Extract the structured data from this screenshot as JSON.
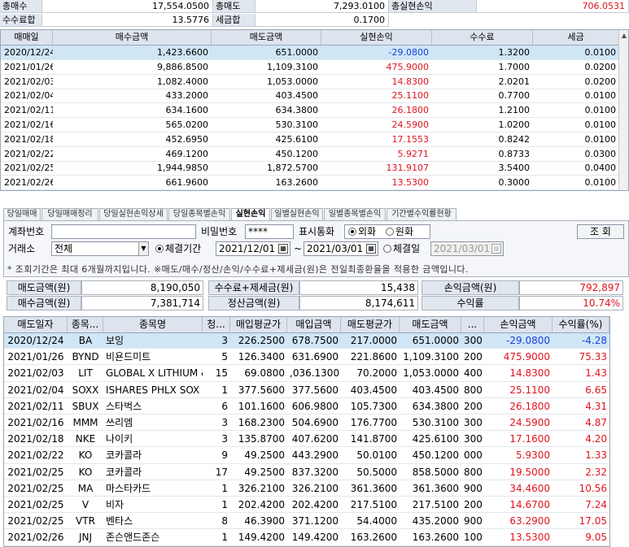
{
  "summary": {
    "row1": [
      {
        "label": "총매수",
        "value": "17,554.0500"
      },
      {
        "label": "총매도",
        "value": "7,293.0100"
      },
      {
        "label": "총실현손익",
        "value": "706.0531"
      }
    ],
    "row2": [
      {
        "label": "수수료합",
        "value": "13.5776"
      },
      {
        "label": "세금합",
        "value": "0.1700"
      }
    ]
  },
  "top_grid": {
    "headers": [
      "매매일",
      "매수금액",
      "매도금액",
      "실현손익",
      "수수료",
      "세금"
    ],
    "rows": [
      [
        "2020/12/24",
        "1,423.6600",
        "651.0000",
        "-29.0800",
        "1.3200",
        "0.0100"
      ],
      [
        "2021/01/26",
        "9,886.8500",
        "1,109.3100",
        "475.9000",
        "1.7000",
        "0.0200"
      ],
      [
        "2021/02/03",
        "1,082.4000",
        "1,053.0000",
        "14.8300",
        "2.0201",
        "0.0200"
      ],
      [
        "2021/02/04",
        "433.2000",
        "403.4500",
        "25.1100",
        "0.7700",
        "0.0100"
      ],
      [
        "2021/02/11",
        "634.1600",
        "634.3800",
        "26.1800",
        "1.2100",
        "0.0100"
      ],
      [
        "2021/02/16",
        "565.0200",
        "530.3100",
        "24.5900",
        "1.0200",
        "0.0100"
      ],
      [
        "2021/02/18",
        "452.6950",
        "425.6100",
        "17.1553",
        "0.8242",
        "0.0100"
      ],
      [
        "2021/02/22",
        "469.1200",
        "450.1200",
        "5.9271",
        "0.8733",
        "0.0300"
      ],
      [
        "2021/02/25",
        "1,944.9850",
        "1,872.5700",
        "131.9107",
        "3.5400",
        "0.0400"
      ],
      [
        "2021/02/26",
        "661.9600",
        "163.2600",
        "13.5300",
        "0.3000",
        "0.0100"
      ]
    ]
  },
  "tabs": [
    "당일매매",
    "당일매매정리",
    "당일실현손익상세",
    "당일종목별손익",
    "실현손익",
    "일별실현손익",
    "일별종목별손익",
    "기간별수익률현황"
  ],
  "form": {
    "account_label": "계좌번호",
    "password_label": "비밀번호",
    "password_value": "****",
    "currency_label": "표시통화",
    "currency_opt1": "외화",
    "currency_opt2": "원화",
    "query_button": "조 회",
    "exchange_label": "거래소",
    "exchange_value": "전체",
    "period_opt1": "체결기간",
    "date_from": "2021/12/01",
    "tilde": "~",
    "date_to": "2021/03/01",
    "period_opt2": "체결일",
    "date_single": "2021/03/01",
    "note": "* 조회기간은 최대 6개월까지입니다.     ※매도/매수/정산/손익/수수료+제세금(원)은 전일최종환율을 적용한 금액입니다."
  },
  "totals": {
    "sell_label": "매도금액(원)",
    "sell_value": "8,190,050",
    "fee_label": "수수료+제세금(원)",
    "fee_value": "15,438",
    "pnl_label": "손익금액(원)",
    "pnl_value": "792,897",
    "buy_label": "매수금액(원)",
    "buy_value": "7,381,714",
    "settle_label": "정산금액(원)",
    "settle_value": "8,174,611",
    "rate_label": "수익률",
    "rate_value": "10.74%"
  },
  "bottom_grid": {
    "headers": [
      "매도일자",
      "종목...",
      "종목명",
      "청...",
      "매입평균가",
      "매입금액",
      "매도평균가",
      "매도금액",
      "...",
      "손익금액",
      "수익률(%)"
    ],
    "rows": [
      [
        "2020/12/24",
        "BA",
        "보잉",
        "3",
        "226.2500",
        "678.7500",
        "217.0000",
        "651.0000",
        "300",
        "-29.0800",
        "-4.28"
      ],
      [
        "2021/01/26",
        "BYND",
        "비욘드미트",
        "5",
        "126.3400",
        "631.6900",
        "221.8600",
        "1,109.3100",
        "200",
        "475.9000",
        "75.33"
      ],
      [
        "2021/02/03",
        "LIT",
        "GLOBAL X LITHIUM &",
        "15",
        "69.0800",
        ",036.1300",
        "70.2000",
        "1,053.0000",
        "400",
        "14.8300",
        "1.43"
      ],
      [
        "2021/02/04",
        "SOXX",
        "ISHARES PHLX SOX SE",
        "1",
        "377.5600",
        "377.5600",
        "403.4500",
        "403.4500",
        "800",
        "25.1100",
        "6.65"
      ],
      [
        "2021/02/11",
        "SBUX",
        "스타벅스",
        "6",
        "101.1600",
        "606.9800",
        "105.7300",
        "634.3800",
        "200",
        "26.1800",
        "4.31"
      ],
      [
        "2021/02/16",
        "MMM",
        "쓰리엠",
        "3",
        "168.2300",
        "504.6900",
        "176.7700",
        "530.3100",
        "300",
        "24.5900",
        "4.87"
      ],
      [
        "2021/02/18",
        "NKE",
        "나이키",
        "3",
        "135.8700",
        "407.6200",
        "141.8700",
        "425.6100",
        "300",
        "17.1600",
        "4.20"
      ],
      [
        "2021/02/22",
        "KO",
        "코카콜라",
        "9",
        "49.2500",
        "443.2900",
        "50.0100",
        "450.1200",
        "000",
        "5.9300",
        "1.33"
      ],
      [
        "2021/02/25",
        "KO",
        "코카콜라",
        "17",
        "49.2500",
        "837.3200",
        "50.5000",
        "858.5000",
        "800",
        "19.5000",
        "2.32"
      ],
      [
        "2021/02/25",
        "MA",
        "마스타카드",
        "1",
        "326.2100",
        "326.2100",
        "361.3600",
        "361.3600",
        "900",
        "34.4600",
        "10.56"
      ],
      [
        "2021/02/25",
        "V",
        "비자",
        "1",
        "202.4200",
        "202.4200",
        "217.5100",
        "217.5100",
        "200",
        "14.6700",
        "7.24"
      ],
      [
        "2021/02/25",
        "VTR",
        "벤타스",
        "8",
        "46.3900",
        "371.1200",
        "54.4000",
        "435.2000",
        "900",
        "63.2900",
        "17.05"
      ],
      [
        "2021/02/26",
        "JNJ",
        "존슨앤드존슨",
        "1",
        "149.4200",
        "149.4200",
        "163.2600",
        "163.2600",
        "100",
        "13.5300",
        "9.05"
      ]
    ]
  },
  "colors": {
    "negative": "#1a3fd6",
    "positive": "#e0141e",
    "selected": "#cfe6f7"
  }
}
